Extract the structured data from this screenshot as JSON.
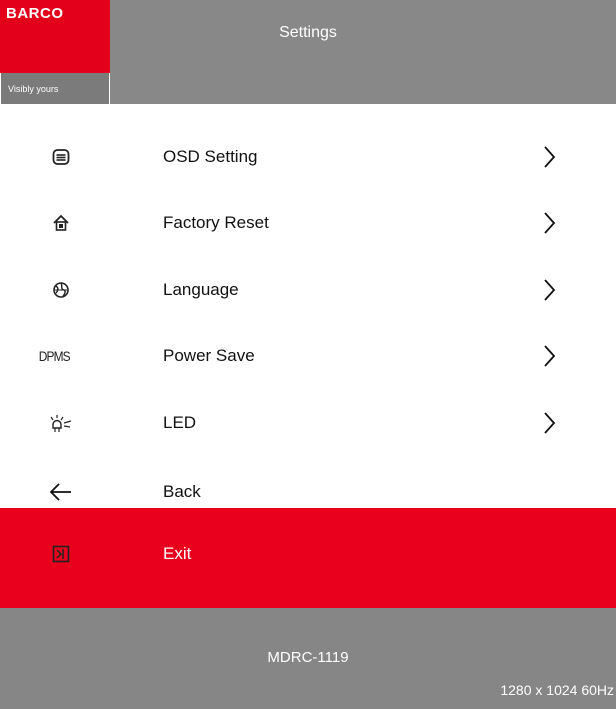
{
  "header": {
    "logo_text": "BARCO",
    "logo_tagline": "Visibly yours",
    "title": "Settings"
  },
  "menu": [
    {
      "label": "OSD Setting",
      "icon": "osd-icon",
      "has_submenu": true
    },
    {
      "label": "Factory Reset",
      "icon": "factory-reset-icon",
      "has_submenu": true
    },
    {
      "label": "Language",
      "icon": "globe-icon",
      "has_submenu": true
    },
    {
      "label": "Power Save",
      "icon": "dpms-icon",
      "icon_text": "DPMS",
      "has_submenu": true
    },
    {
      "label": "LED",
      "icon": "led-icon",
      "has_submenu": true
    },
    {
      "label": "Back",
      "icon": "back-arrow-icon",
      "has_submenu": false
    },
    {
      "label": "Exit",
      "icon": "exit-icon",
      "has_submenu": false,
      "selected": true
    }
  ],
  "footer": {
    "model": "MDRC-1119",
    "resolution": "1280 x 1024 60Hz"
  },
  "colors": {
    "brand_red": "#e2001a",
    "selected_row": "#e8001c",
    "header_gray": "#888888",
    "footer_gray": "#868686"
  }
}
